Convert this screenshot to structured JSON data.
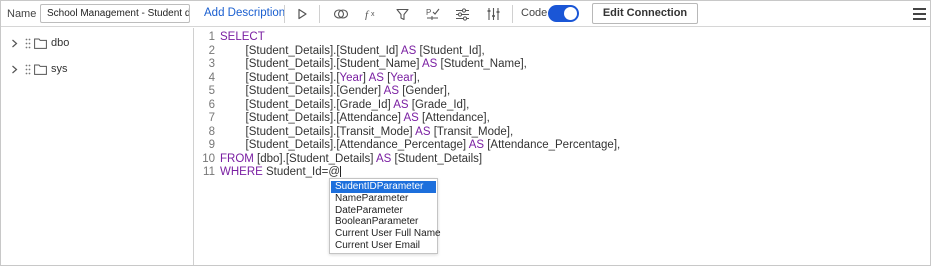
{
  "toolbar": {
    "name_label": "Name",
    "name_value": "School Management - Student dataso",
    "add_description": "Add Description",
    "code_label": "Code",
    "code_enabled": true,
    "edit_connection": "Edit Connection",
    "accent_color": "#1a56d6",
    "icons": [
      "play-icon",
      "preview-icon",
      "fx-icon",
      "filter-icon",
      "parameter-icon",
      "settings-sliders-icon",
      "column-sliders-icon",
      "hamburger-menu-icon"
    ]
  },
  "tree": {
    "items": [
      {
        "label": "dbo"
      },
      {
        "label": "sys"
      }
    ]
  },
  "editor": {
    "line_numbers": [
      "1",
      "2",
      "3",
      "4",
      "5",
      "6",
      "7",
      "8",
      "9",
      "10",
      "11"
    ],
    "lines": [
      [
        {
          "t": "SELECT",
          "k": true
        }
      ],
      [
        {
          "t": "        [Student_Details].[Student_Id] "
        },
        {
          "t": "AS",
          "k": true
        },
        {
          "t": " [Student_Id],"
        }
      ],
      [
        {
          "t": "        [Student_Details].[Student_Name] "
        },
        {
          "t": "AS",
          "k": true
        },
        {
          "t": " [Student_Name],"
        }
      ],
      [
        {
          "t": "        [Student_Details].["
        },
        {
          "t": "Year",
          "k": true
        },
        {
          "t": "] "
        },
        {
          "t": "AS",
          "k": true
        },
        {
          "t": " ["
        },
        {
          "t": "Year",
          "k": true
        },
        {
          "t": "],"
        }
      ],
      [
        {
          "t": "        [Student_Details].[Gender] "
        },
        {
          "t": "AS",
          "k": true
        },
        {
          "t": " [Gender],"
        }
      ],
      [
        {
          "t": "        [Student_Details].[Grade_Id] "
        },
        {
          "t": "AS",
          "k": true
        },
        {
          "t": " [Grade_Id],"
        }
      ],
      [
        {
          "t": "        [Student_Details].[Attendance] "
        },
        {
          "t": "AS",
          "k": true
        },
        {
          "t": " [Attendance],"
        }
      ],
      [
        {
          "t": "        [Student_Details].[Transit_Mode] "
        },
        {
          "t": "AS",
          "k": true
        },
        {
          "t": " [Transit_Mode],"
        }
      ],
      [
        {
          "t": "        [Student_Details].[Attendance_Percentage] "
        },
        {
          "t": "AS",
          "k": true
        },
        {
          "t": " [Attendance_Percentage],"
        }
      ],
      [
        {
          "t": "FROM",
          "k": true
        },
        {
          "t": " [dbo].[Student_Details] "
        },
        {
          "t": "AS",
          "k": true
        },
        {
          "t": " [Student_Details]"
        }
      ],
      [
        {
          "t": "WHERE",
          "k": true
        },
        {
          "t": " Student_Id=@"
        }
      ]
    ],
    "keyword_color": "#7a1fa2"
  },
  "autocomplete": {
    "selected_index": 0,
    "items": [
      "SudentIDParameter",
      "NameParameter",
      "DateParameter",
      "BooleanParameter",
      "Current User Full Name",
      "Current User Email"
    ]
  }
}
